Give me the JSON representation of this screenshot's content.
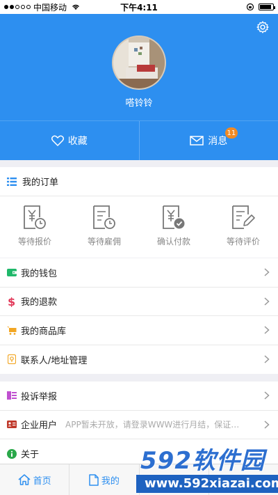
{
  "status_bar": {
    "carrier": "中国移动",
    "time": "下午4:11"
  },
  "profile": {
    "username": "嗒铃铃"
  },
  "actions": {
    "favorites_label": "收藏",
    "messages_label": "消息",
    "messages_badge": "11"
  },
  "orders": {
    "title": "我的订单",
    "items": [
      {
        "label": "等待报价",
        "icon": "price-clock-icon"
      },
      {
        "label": "等待雇佣",
        "icon": "hire-clock-icon"
      },
      {
        "label": "确认付款",
        "icon": "payment-check-icon"
      },
      {
        "label": "等待评价",
        "icon": "review-pen-icon"
      }
    ]
  },
  "menu_group_1": [
    {
      "label": "我的钱包",
      "icon": "wallet-icon",
      "color": "#1fb86a"
    },
    {
      "label": "我的退款",
      "icon": "dollar-icon",
      "color": "#e23a5a"
    },
    {
      "label": "我的商品库",
      "icon": "cart-icon",
      "color": "#f2a623"
    },
    {
      "label": "联系人/地址管理",
      "icon": "location-icon",
      "color": "#f2a623"
    }
  ],
  "menu_group_2": [
    {
      "label": "投诉举报",
      "icon": "report-icon",
      "color": "#c050d0"
    },
    {
      "label": "企业用户",
      "icon": "enterprise-card-icon",
      "color": "#c0392b",
      "hint": "APP暂未开放，请登录WWW进行月结，保证业务…"
    },
    {
      "label": "关于",
      "icon": "info-icon",
      "color": "#2aa84a"
    }
  ],
  "tabbar": {
    "home_label": "首页",
    "mine_label": "我的"
  },
  "watermark": {
    "brand": "592软件园",
    "url": "www.592xiazai.com"
  }
}
